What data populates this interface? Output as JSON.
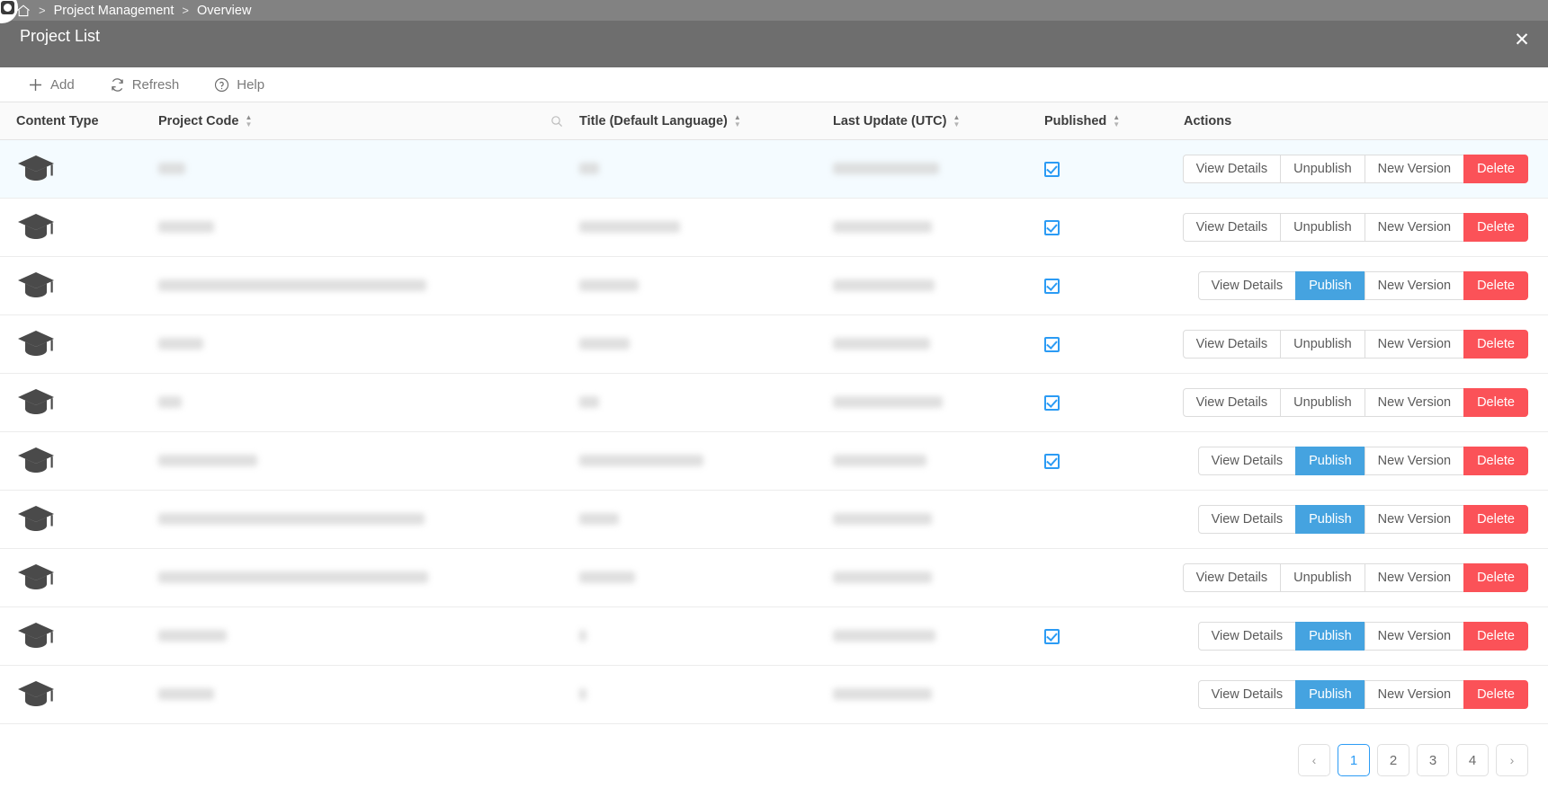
{
  "window": {
    "breadcrumb": [
      {
        "label": "home-icon",
        "type": "icon"
      },
      {
        "label": "Project Management",
        "type": "link"
      },
      {
        "label": "Overview",
        "type": "link"
      }
    ],
    "separator": ">",
    "page_title": "Project List",
    "close_label": "✕",
    "corner_badge": "app-avatar"
  },
  "toolbar": {
    "items": [
      {
        "icon": "plus-icon",
        "label": "Add"
      },
      {
        "icon": "refresh-icon",
        "label": "Refresh"
      },
      {
        "icon": "help-icon",
        "label": "Help"
      }
    ]
  },
  "table": {
    "columns": [
      {
        "key": "content_type",
        "label": "Content Type",
        "sortable": false,
        "search": false
      },
      {
        "key": "project_code",
        "label": "Project Code",
        "sortable": true,
        "search": true
      },
      {
        "key": "title",
        "label": "Title (Default Language)",
        "sortable": true,
        "search": false
      },
      {
        "key": "last_update",
        "label": "Last Update (UTC)",
        "sortable": true,
        "search": false
      },
      {
        "key": "published",
        "label": "Published",
        "sortable": true,
        "search": false
      },
      {
        "key": "actions",
        "label": "Actions",
        "sortable": false,
        "search": false
      }
    ],
    "action_labels": {
      "view_details": "View Details",
      "publish": "Publish",
      "unpublish": "Unpublish",
      "new_version": "New Version",
      "delete": "Delete"
    },
    "rows": [
      {
        "icon": "graduation-cap-icon",
        "code_w": 30,
        "title_w": 22,
        "date_w": 118,
        "published": true,
        "toggle": "unpublish",
        "hovered": true
      },
      {
        "icon": "graduation-cap-icon",
        "code_w": 62,
        "title_w": 112,
        "date_w": 110,
        "published": true,
        "toggle": "unpublish",
        "hovered": false
      },
      {
        "icon": "graduation-cap-icon",
        "code_w": 298,
        "title_w": 66,
        "date_w": 113,
        "published": true,
        "toggle": "publish",
        "hovered": false
      },
      {
        "icon": "graduation-cap-icon",
        "code_w": 50,
        "title_w": 56,
        "date_w": 108,
        "published": true,
        "toggle": "unpublish",
        "hovered": false
      },
      {
        "icon": "graduation-cap-icon",
        "code_w": 26,
        "title_w": 22,
        "date_w": 122,
        "published": true,
        "toggle": "unpublish",
        "hovered": false
      },
      {
        "icon": "graduation-cap-icon",
        "code_w": 110,
        "title_w": 138,
        "date_w": 104,
        "published": true,
        "toggle": "publish",
        "hovered": false
      },
      {
        "icon": "graduation-cap-icon",
        "code_w": 296,
        "title_w": 44,
        "date_w": 110,
        "published": false,
        "toggle": "publish",
        "hovered": false
      },
      {
        "icon": "graduation-cap-icon",
        "code_w": 300,
        "title_w": 62,
        "date_w": 110,
        "published": false,
        "toggle": "unpublish",
        "hovered": false
      },
      {
        "icon": "graduation-cap-icon",
        "code_w": 76,
        "title_w": 8,
        "date_w": 114,
        "published": true,
        "toggle": "publish",
        "hovered": false
      },
      {
        "icon": "graduation-cap-icon",
        "code_w": 62,
        "title_w": 8,
        "date_w": 110,
        "published": false,
        "toggle": "publish",
        "hovered": false
      }
    ]
  },
  "pagination": {
    "prev": "‹",
    "next": "›",
    "pages": [
      "1",
      "2",
      "3",
      "4"
    ],
    "current": "1"
  },
  "colors": {
    "chrome": "#6e6e6e",
    "breadcrumb_bar": "#828282",
    "primary": "#45a3e0",
    "danger": "#fb5258",
    "checkbox": "#2b9bf4",
    "active_page": "#2d9cf5"
  }
}
